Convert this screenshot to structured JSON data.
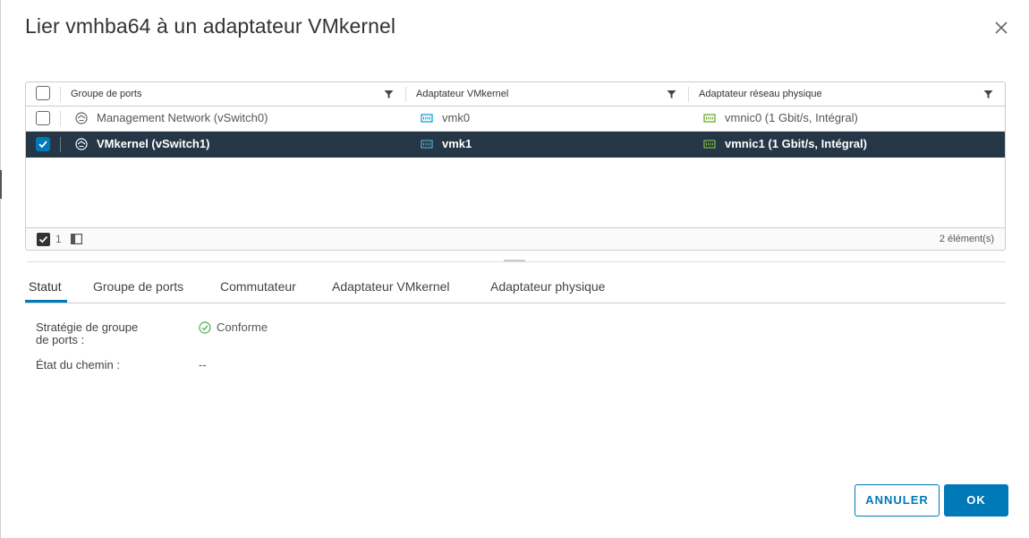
{
  "dialog": {
    "title": "Lier vmhba64 à un adaptateur VMkernel"
  },
  "grid": {
    "columns": [
      "Groupe de ports",
      "Adaptateur VMkernel",
      "Adaptateur réseau physique"
    ],
    "rows": [
      {
        "port_group": "Management Network (vSwitch0)",
        "vmkernel": "vmk0",
        "physical": "vmnic0 (1 Gbit/s, Intégral)",
        "selected": false
      },
      {
        "port_group": "VMkernel (vSwitch1)",
        "vmkernel": "vmk1",
        "physical": "vmnic1 (1 Gbit/s, Intégral)",
        "selected": true
      }
    ],
    "footer": {
      "selected_count": "1",
      "total": "2 élément(s)"
    }
  },
  "tabs": [
    "Statut",
    "Groupe de ports",
    "Commutateur",
    "Adaptateur VMkernel",
    "Adaptateur physique"
  ],
  "status": {
    "policy_label": "Stratégie de groupe de ports :",
    "policy_label_line1": "Stratégie de groupe",
    "policy_label_line2": "de ports :",
    "policy_value": "Conforme",
    "path_label": "État du chemin :",
    "path_value": "--"
  },
  "buttons": {
    "cancel": "ANNULER",
    "ok": "OK"
  },
  "colors": {
    "accent": "#0079b8",
    "selected_row": "#253746",
    "ok_green": "#4caf50",
    "vmk_blue": "#0095d3",
    "nic_green": "#62a420"
  },
  "icons": {
    "close": "close-icon",
    "filter": "filter-icon",
    "port_group": "port-group-icon",
    "vmkernel": "vmkernel-adapter-icon",
    "physical_nic": "physical-nic-icon",
    "status_ok": "check-circle-icon",
    "columns": "column-toggle-icon"
  }
}
